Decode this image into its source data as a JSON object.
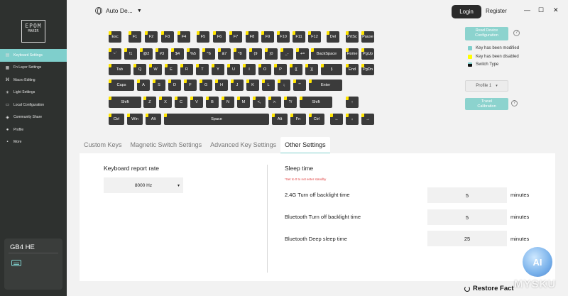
{
  "brand": {
    "logo_text": "EPOM",
    "logo_sub": "MAKER"
  },
  "sidebar": {
    "items": [
      {
        "label": "Keyboard Settings",
        "icon": "keyboard-icon",
        "active": true
      },
      {
        "label": "Fn Layer Settings",
        "icon": "layers-icon",
        "active": false
      },
      {
        "label": "Macro Editing",
        "icon": "macro-icon",
        "active": false
      },
      {
        "label": "Light Settings",
        "icon": "bulb-icon",
        "active": false
      },
      {
        "label": "Local Configuration",
        "icon": "folder-icon",
        "active": false
      },
      {
        "label": "Community Share",
        "icon": "share-icon",
        "active": false
      },
      {
        "label": "Profile",
        "icon": "user-icon",
        "active": false
      },
      {
        "label": "More",
        "icon": "more-icon",
        "active": false
      }
    ],
    "device": {
      "name": "GB4 HE",
      "icon": "keyboard-icon"
    }
  },
  "topbar": {
    "language": "Auto De...",
    "login": "Login",
    "register": "Register",
    "controls": [
      "—",
      "☐",
      "✕"
    ]
  },
  "keyboard": {
    "rows": [
      [
        "Esc",
        "F1",
        "F2",
        "F3",
        "F4",
        "F5",
        "F6",
        "F7",
        "F8",
        "F9",
        "F10",
        "F11",
        "F12",
        "Del",
        "PrtSc",
        "Pause"
      ],
      [
        "~`",
        "!1",
        "@2",
        "#3",
        "$4",
        "%5",
        "^6",
        "&7",
        "*8",
        "(9",
        ")0",
        "_-",
        "+=",
        "BackSpace",
        "Home",
        "PgUp"
      ],
      [
        "Tab",
        "Q",
        "W",
        "E",
        "R",
        "T",
        "Y",
        "U",
        "I",
        "O",
        "P",
        "{[",
        "}]",
        "|\\",
        "End",
        "PgDn"
      ],
      [
        "Caps",
        "A",
        "S",
        "D",
        "F",
        "G",
        "H",
        "J",
        "K",
        "L",
        ":;",
        "\"'",
        "Enter"
      ],
      [
        "Shift",
        "Z",
        "X",
        "C",
        "V",
        "B",
        "N",
        "M",
        "<,",
        ">.",
        "?/",
        "Shift",
        "↑"
      ],
      [
        "Ctrl",
        "Win",
        "Alt",
        "Space",
        "Alt",
        "Fn",
        "Ctrl",
        "←",
        "↓",
        "→"
      ]
    ]
  },
  "right_panel": {
    "read_device_line1": "Read Device",
    "read_device_line2": "Configuration",
    "legend": [
      {
        "label": "Key has been modified",
        "color": "#7fcfcc"
      },
      {
        "label": "Key has been disabled",
        "color": "#ffff00"
      },
      {
        "label": "Switch Type",
        "color": "#111111"
      }
    ],
    "profile": "Profile 1",
    "travel_line1": "Travel",
    "travel_line2": "Calibration"
  },
  "tabs": [
    {
      "label": "Custom Keys",
      "active": false
    },
    {
      "label": "Magnetic Switch Settings",
      "active": false
    },
    {
      "label": "Advanced Key Settings",
      "active": false
    },
    {
      "label": "Other Settings",
      "active": true
    }
  ],
  "settings": {
    "report_rate_label": "Keyboard report rate",
    "report_rate_value": "8000 Hz",
    "sleep_title": "Sleep time",
    "sleep_note": "*Set to 0 to not enter standby",
    "rows": [
      {
        "label": "2.4G Turn off backlight time",
        "value": "5",
        "unit": "minutes"
      },
      {
        "label": "Bluetooth Turn off backlight time",
        "value": "5",
        "unit": "minutes"
      },
      {
        "label": "Bluetooth Deep sleep time",
        "value": "25",
        "unit": "minutes"
      }
    ]
  },
  "footer": {
    "restore": "Restore Fact"
  },
  "watermark": {
    "badge": "AI",
    "text": "MYSKU"
  }
}
